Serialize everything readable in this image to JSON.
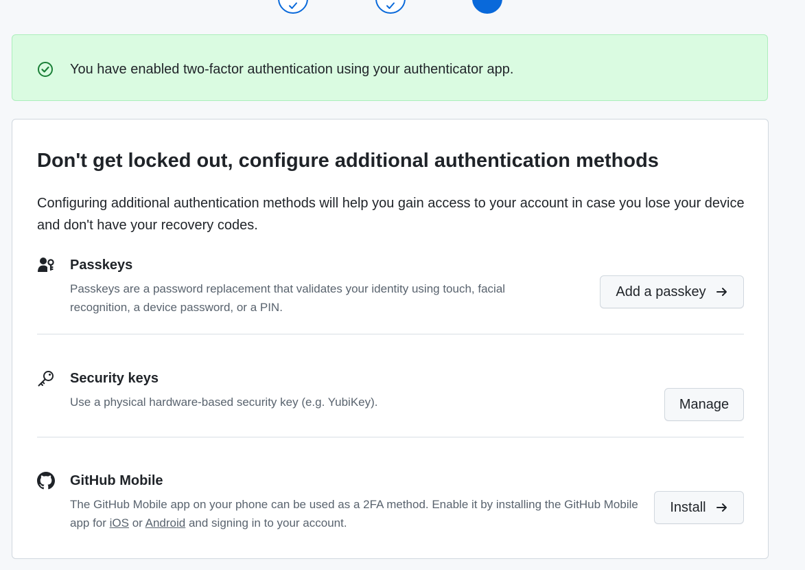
{
  "stepper": {
    "steps": [
      {
        "state": "complete",
        "icon": "check-icon"
      },
      {
        "state": "complete",
        "icon": "check-icon"
      },
      {
        "state": "current"
      }
    ],
    "accent_color": "#0969da"
  },
  "flash": {
    "icon": "check-circle-icon",
    "message": "You have enabled two-factor authentication using your authenticator app.",
    "background_color": "#dafbe1"
  },
  "card": {
    "title": "Don't get locked out, configure additional authentication methods",
    "description": "Configuring additional authentication methods will help you gain access to your account in case you lose your device and don't have your recovery codes.",
    "methods": [
      {
        "icon": "passkey-icon",
        "title": "Passkeys",
        "description": "Passkeys are a password replacement that validates your identity using touch, facial recognition, a device password, or a PIN.",
        "button_label": "Add a passkey",
        "button_icon": "arrow-right-icon"
      },
      {
        "icon": "key-icon",
        "title": "Security keys",
        "description": "Use a physical hardware-based security key (e.g. YubiKey).",
        "button_label": "Manage"
      },
      {
        "icon": "github-mark-icon",
        "title": "GitHub Mobile",
        "description_before_ios": "The GitHub Mobile app on your phone can be used as a 2FA method. Enable it by installing the GitHub Mobile app for ",
        "ios_link": "iOS",
        "description_between": " or ",
        "android_link": "Android",
        "description_after": " and signing in to your account.",
        "button_label": "Install",
        "button_icon": "arrow-right-icon"
      }
    ]
  }
}
